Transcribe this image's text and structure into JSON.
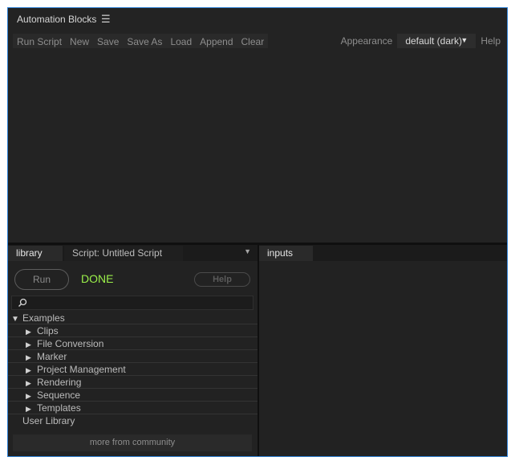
{
  "window": {
    "title": "Automation Blocks",
    "menu_icon": "hamburger-icon"
  },
  "toolbar": {
    "items": [
      "Run Script",
      "New",
      "Save",
      "Save As",
      "Load",
      "Append",
      "Clear"
    ],
    "appearance_label": "Appearance",
    "appearance_value": "default (dark)",
    "help_label": "Help"
  },
  "left_pane": {
    "tabs": [
      "library",
      "Script: Untitled Script"
    ],
    "active_tab": "library",
    "run_label": "Run",
    "status": "DONE",
    "help_label": "Help",
    "search_placeholder": "",
    "tree": {
      "root": "Examples",
      "children": [
        "Clips",
        "File Conversion",
        "Marker",
        "Project Management",
        "Rendering",
        "Sequence",
        "Templates"
      ],
      "user_library": "User Library"
    },
    "community_label": "more from community"
  },
  "right_pane": {
    "tabs": [
      "inputs"
    ]
  },
  "colors": {
    "panel_border": "#2d7fd3",
    "status_done": "#9bf04a",
    "background": "#232323"
  }
}
